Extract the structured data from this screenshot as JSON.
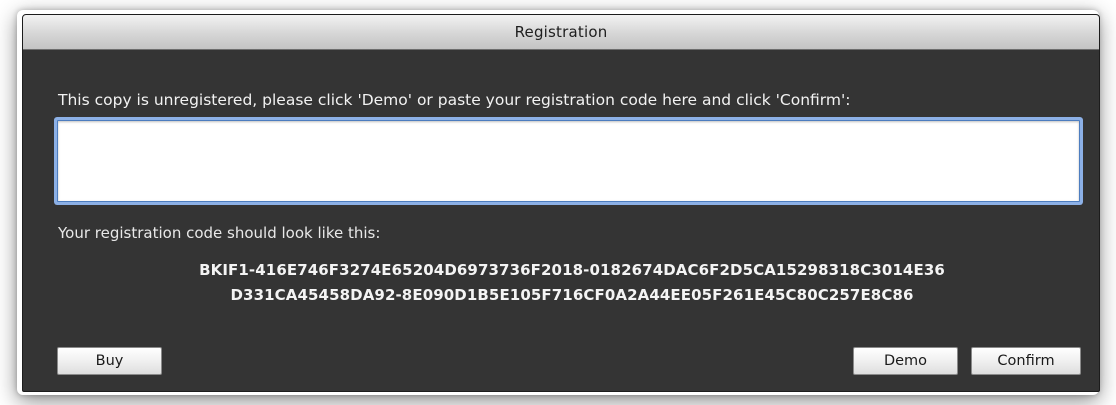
{
  "window": {
    "title": "Registration"
  },
  "dialog": {
    "instruction": "This copy is unregistered, please click 'Demo' or paste your registration code here and click 'Confirm':",
    "code_input": {
      "value": "",
      "placeholder": ""
    },
    "hint_label": "Your registration code should look like this:",
    "example_code": {
      "line1": "BKIF1-416E746F3274E65204D6973736F2018-0182674DAC6F2D5CA15298318C3014E36",
      "line2": "D331CA45458DA92-8E090D1B5E105F716CF0A2A44EE05F261E45C80C257E8C86"
    }
  },
  "buttons": {
    "buy_label": "Buy",
    "demo_label": "Demo",
    "confirm_label": "Confirm"
  },
  "colors": {
    "dialog_background": "#343434",
    "focus_ring": "#8cb0e6"
  }
}
